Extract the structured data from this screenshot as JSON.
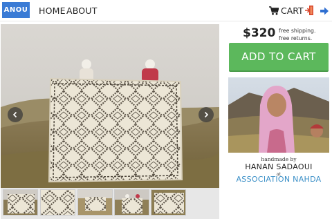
{
  "header": {
    "logo": "ANOU",
    "nav": {
      "home": "HOME",
      "about": "ABOUT"
    },
    "cart_label": "CART"
  },
  "product": {
    "price": "$320",
    "shipping_line1": "free shipping.",
    "shipping_line2": "free returns.",
    "add_to_cart": "ADD TO CART",
    "handmade_by": "handmade by",
    "artisan": "HANAN SADAOUI",
    "at": "at",
    "association": "ASSOCIATION NAHDA"
  },
  "gallery": {
    "thumbnail_count": 5
  },
  "colors": {
    "logo_bg": "#3a7bd5",
    "add_button": "#5cb85c",
    "association_link": "#3a8fc7",
    "logout_icon": "#d9462b",
    "arrow_icon": "#2f6fd1"
  }
}
